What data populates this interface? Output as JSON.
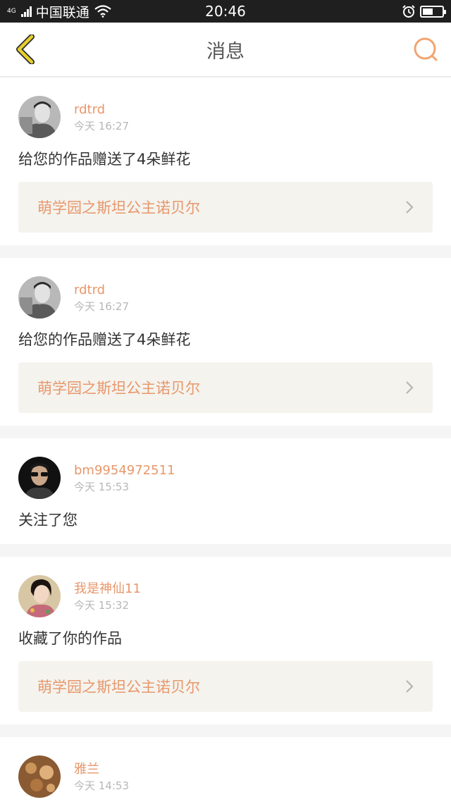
{
  "status_bar": {
    "network": "4G",
    "carrier": "中国联通",
    "time": "20:46",
    "battery_level": 0.55,
    "icons": [
      "signal-icon",
      "wifi-icon",
      "alarm-icon",
      "battery-icon"
    ]
  },
  "header": {
    "title": "消息",
    "back_icon": "chevron-left-icon",
    "search_icon": "search-icon"
  },
  "colors": {
    "accent": "#e8976b",
    "back_icon": "#d4b400",
    "work_bg": "#f4f3ee"
  },
  "messages": [
    {
      "username": "rdtrd",
      "time": "今天 16:27",
      "action": "给您的作品赠送了4朵鲜花",
      "work_title": "萌学园之斯坦公主诺贝尔"
    },
    {
      "username": "rdtrd",
      "time": "今天 16:27",
      "action": "给您的作品赠送了4朵鲜花",
      "work_title": "萌学园之斯坦公主诺贝尔"
    },
    {
      "username": "bm9954972511",
      "time": "今天 15:53",
      "action": "关注了您"
    },
    {
      "username": "我是神仙11",
      "time": "今天 15:32",
      "action": "收藏了你的作品",
      "work_title": "萌学园之斯坦公主诺贝尔"
    },
    {
      "username": "雅兰",
      "time": "今天 14:53"
    }
  ]
}
